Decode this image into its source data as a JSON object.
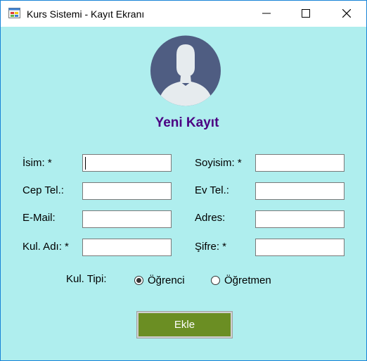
{
  "window": {
    "title": "Kurs Sistemi - Kayıt Ekranı"
  },
  "form": {
    "heading": "Yeni Kayıt",
    "fields": [
      {
        "label": "İsim: *",
        "value": ""
      },
      {
        "label": "Soyisim: *",
        "value": ""
      },
      {
        "label": "Cep Tel.:",
        "value": ""
      },
      {
        "label": "Ev Tel.:",
        "value": ""
      },
      {
        "label": "E-Mail:",
        "value": ""
      },
      {
        "label": "Adres:",
        "value": ""
      },
      {
        "label": "Kul. Adı: *",
        "value": ""
      },
      {
        "label": "Şifre: *",
        "value": ""
      }
    ],
    "user_type": {
      "label": "Kul. Tipi:",
      "options": [
        "Öğrenci",
        "Öğretmen"
      ],
      "selected": "Öğrenci"
    },
    "submit_label": "Ekle"
  },
  "colors": {
    "background": "#afeeee",
    "heading": "#4b0082",
    "button": "#6b8e23",
    "avatar_bg": "#4f5d82",
    "avatar_fg": "#e6ebee"
  },
  "icons": {
    "app": "app-window-icon",
    "minimize": "minimize-icon",
    "maximize": "maximize-icon",
    "close": "close-icon",
    "avatar": "user-avatar-icon"
  }
}
